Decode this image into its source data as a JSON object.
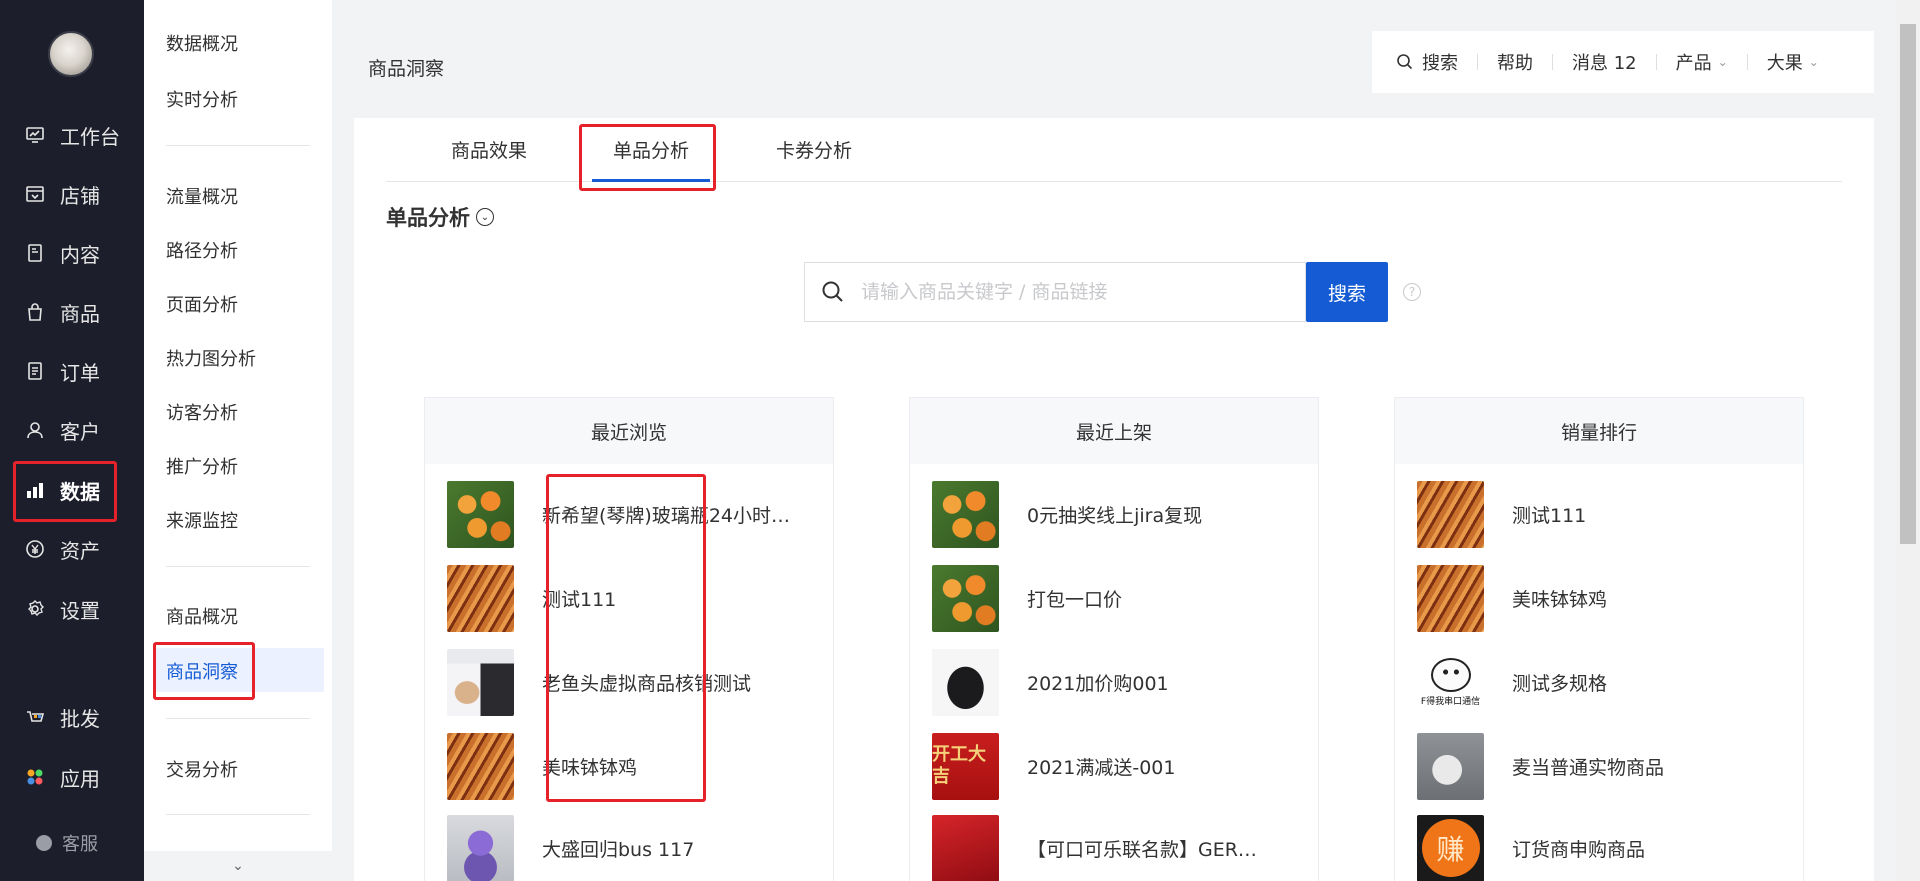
{
  "nav_primary": {
    "items": [
      {
        "label": "工作台",
        "icon": "dashboard-icon"
      },
      {
        "label": "店铺",
        "icon": "shop-icon"
      },
      {
        "label": "内容",
        "icon": "content-icon"
      },
      {
        "label": "商品",
        "icon": "bag-icon"
      },
      {
        "label": "订单",
        "icon": "order-icon"
      },
      {
        "label": "客户",
        "icon": "user-icon"
      },
      {
        "label": "数据",
        "icon": "chart-icon"
      },
      {
        "label": "资产",
        "icon": "yuan-icon"
      },
      {
        "label": "设置",
        "icon": "gear-icon"
      },
      {
        "label": "批发",
        "icon": "wholesale-icon"
      },
      {
        "label": "应用",
        "icon": "apps-icon"
      }
    ],
    "active": "数据",
    "kefu": "客服"
  },
  "nav_secondary": {
    "groups": [
      [
        "数据概况",
        "实时分析"
      ],
      [
        "流量概况",
        "路径分析",
        "页面分析",
        "热力图分析",
        "访客分析",
        "推广分析",
        "来源监控"
      ],
      [
        "商品概况",
        "商品洞察"
      ],
      [
        "交易分析"
      ]
    ],
    "active": "商品洞察"
  },
  "page": {
    "title": "商品洞察"
  },
  "topbar": {
    "search": "搜索",
    "help": "帮助",
    "messages": "消息 12",
    "product": "产品",
    "user": "大果"
  },
  "tabs": [
    "商品效果",
    "单品分析",
    "卡券分析"
  ],
  "active_tab": "单品分析",
  "section": {
    "title": "单品分析"
  },
  "search": {
    "placeholder": "请输入商品关键字 / 商品链接",
    "value": "",
    "button": "搜索"
  },
  "panels": [
    {
      "title": "最近浏览",
      "items": [
        {
          "name": "新希望(琴牌)玻璃瓶24小时…",
          "thumb": "orange"
        },
        {
          "name": "测试111",
          "thumb": "chicken"
        },
        {
          "name": "老鱼头虚拟商品核销测试",
          "thumb": "cosmetic"
        },
        {
          "name": "美味钵钵鸡",
          "thumb": "chicken"
        },
        {
          "name": "大盛回归bus 117",
          "thumb": "doll"
        }
      ]
    },
    {
      "title": "最近上架",
      "items": [
        {
          "name": "0元抽奖线上jira复现",
          "thumb": "orange"
        },
        {
          "name": "打包一口价",
          "thumb": "orange"
        },
        {
          "name": "2021加价购001",
          "thumb": "shirt"
        },
        {
          "name": "2021满减送-001",
          "thumb": "redposter"
        },
        {
          "name": "【可口可乐联名款】GER…",
          "thumb": "redgift"
        }
      ]
    },
    {
      "title": "销量排行",
      "items": [
        {
          "name": "测试111",
          "thumb": "chicken"
        },
        {
          "name": "美味钵钵鸡",
          "thumb": "chicken"
        },
        {
          "name": "测试多规格",
          "thumb": "meme"
        },
        {
          "name": "麦当普通实物商品",
          "thumb": "dog"
        },
        {
          "name": "订货商申购商品",
          "thumb": "zhuan"
        }
      ]
    }
  ],
  "thumb_text": {
    "redposter": "开工大吉",
    "meme": "F得我串口通信",
    "zhuan": "赚"
  },
  "colors": {
    "accent": "#155bd4",
    "highlight": "#e5212a",
    "nav_bg": "#1c1e2b"
  }
}
